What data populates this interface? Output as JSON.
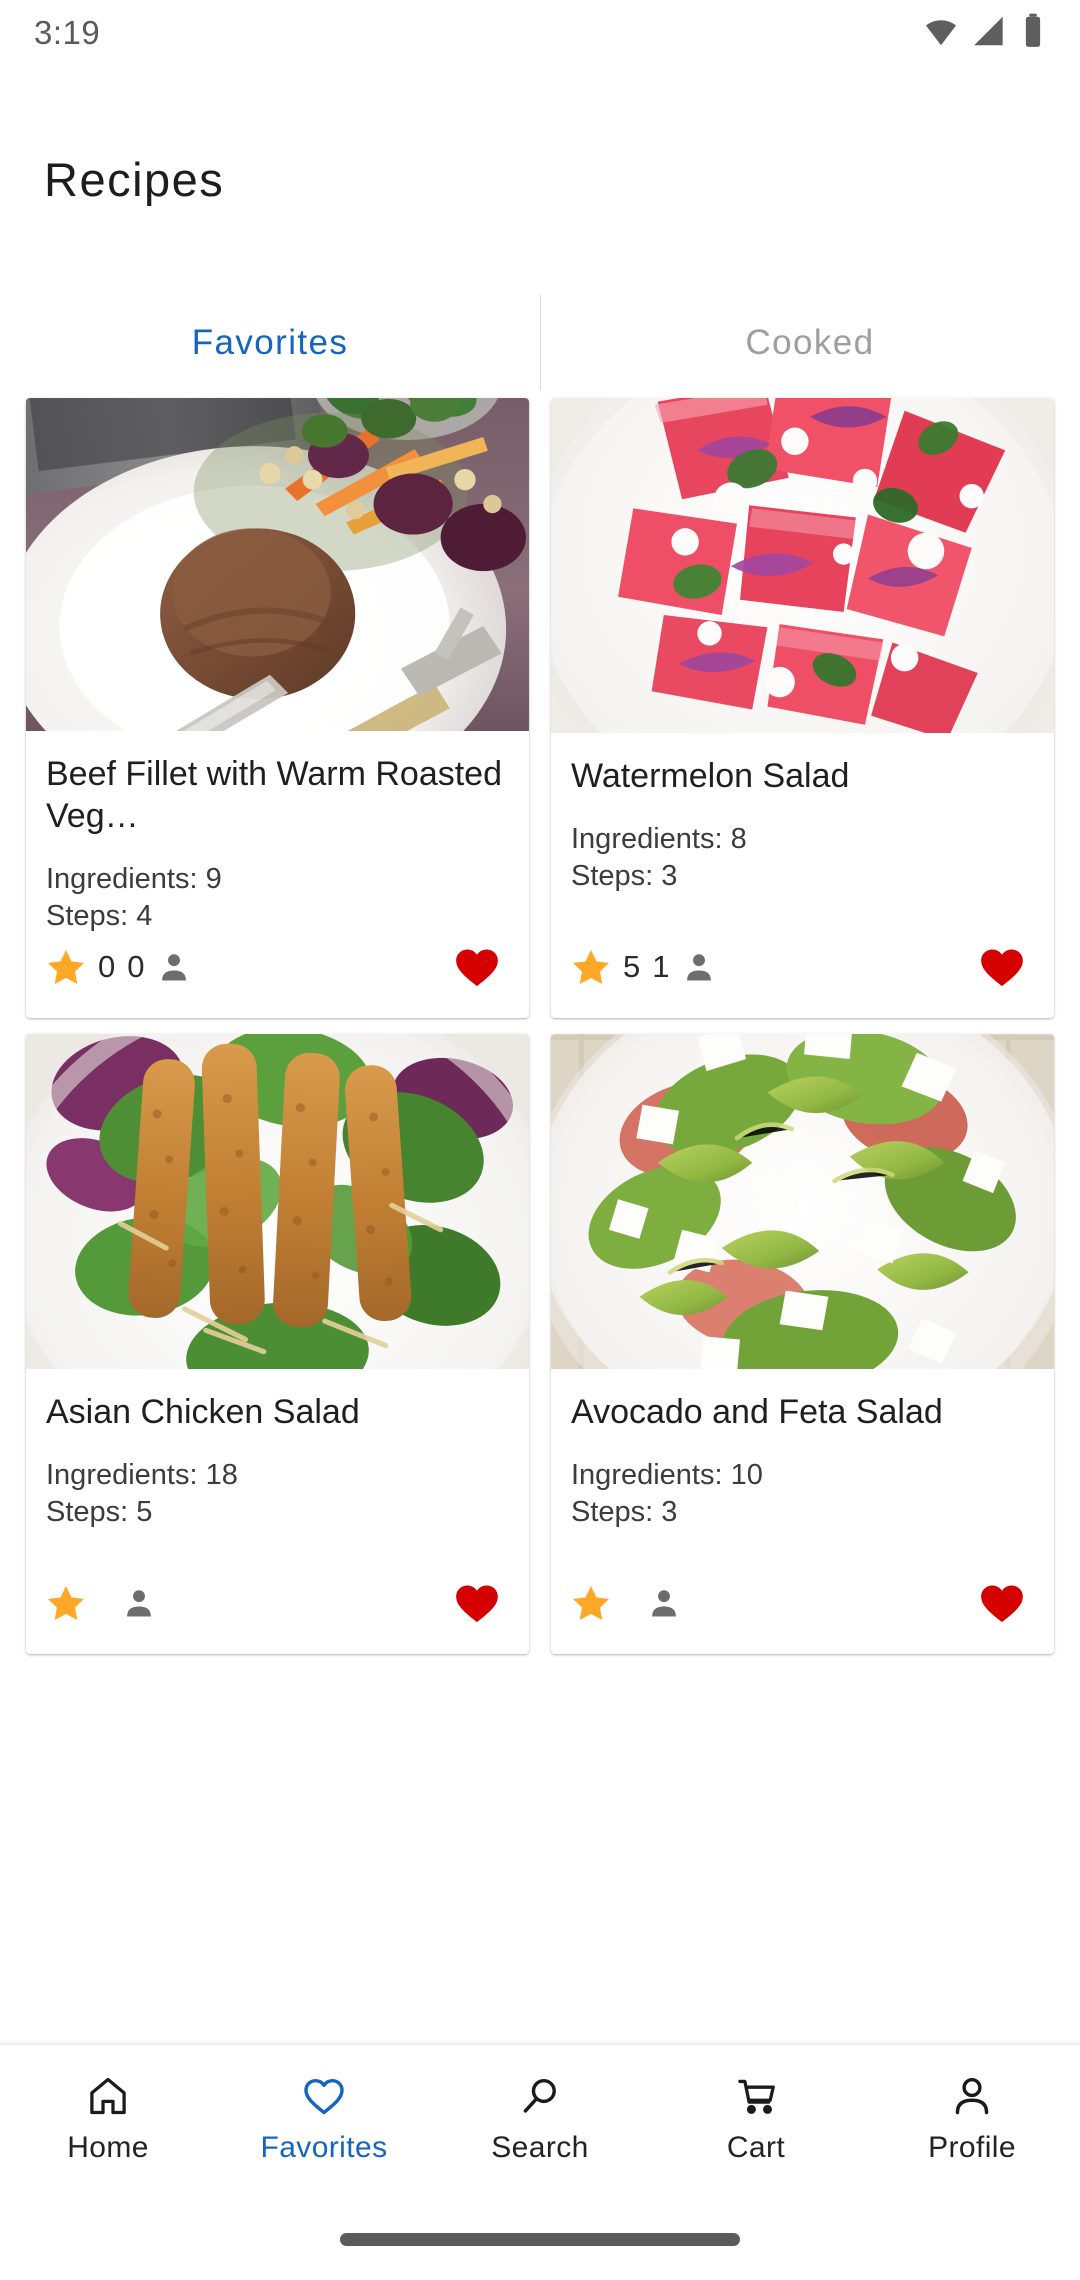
{
  "status_bar": {
    "time": "3:19",
    "icons": [
      "wifi-icon",
      "cellular-signal-icon",
      "battery-icon"
    ]
  },
  "header": {
    "title": "Recipes"
  },
  "tabs": [
    {
      "label": "Favorites",
      "active": true
    },
    {
      "label": "Cooked",
      "active": false
    }
  ],
  "colors": {
    "accent": "#1565c0",
    "star": "#FFA726",
    "heart": "#D50000",
    "inactive_tab": "#9e9e9e",
    "text": "#1f1f1f"
  },
  "recipes": [
    {
      "title": "Beef Fillet with Warm Roasted Veg…",
      "ingredients_label": "Ingredients: 9",
      "steps_label": "Steps: 4",
      "rating": "0",
      "servings": "0",
      "favorite": true,
      "image_alt": "beef-fillet-plate-photo"
    },
    {
      "title": "Watermelon Salad",
      "ingredients_label": "Ingredients: 8",
      "steps_label": "Steps: 3",
      "rating": "5",
      "servings": "1",
      "favorite": true,
      "image_alt": "watermelon-salad-bowl-photo"
    },
    {
      "title": "Asian Chicken Salad",
      "ingredients_label": "Ingredients: 18",
      "steps_label": "Steps: 5",
      "rating": "",
      "servings": "",
      "favorite": true,
      "image_alt": "asian-chicken-salad-photo"
    },
    {
      "title": "Avocado and Feta Salad",
      "ingredients_label": "Ingredients: 10",
      "steps_label": "Steps: 3",
      "rating": "",
      "servings": "",
      "favorite": true,
      "image_alt": "avocado-feta-salad-photo"
    }
  ],
  "bottom_nav": [
    {
      "label": "Home",
      "icon": "home-icon",
      "active": false
    },
    {
      "label": "Favorites",
      "icon": "heart-icon",
      "active": true
    },
    {
      "label": "Search",
      "icon": "search-icon",
      "active": false
    },
    {
      "label": "Cart",
      "icon": "cart-icon",
      "active": false
    },
    {
      "label": "Profile",
      "icon": "person-icon",
      "active": false
    }
  ]
}
